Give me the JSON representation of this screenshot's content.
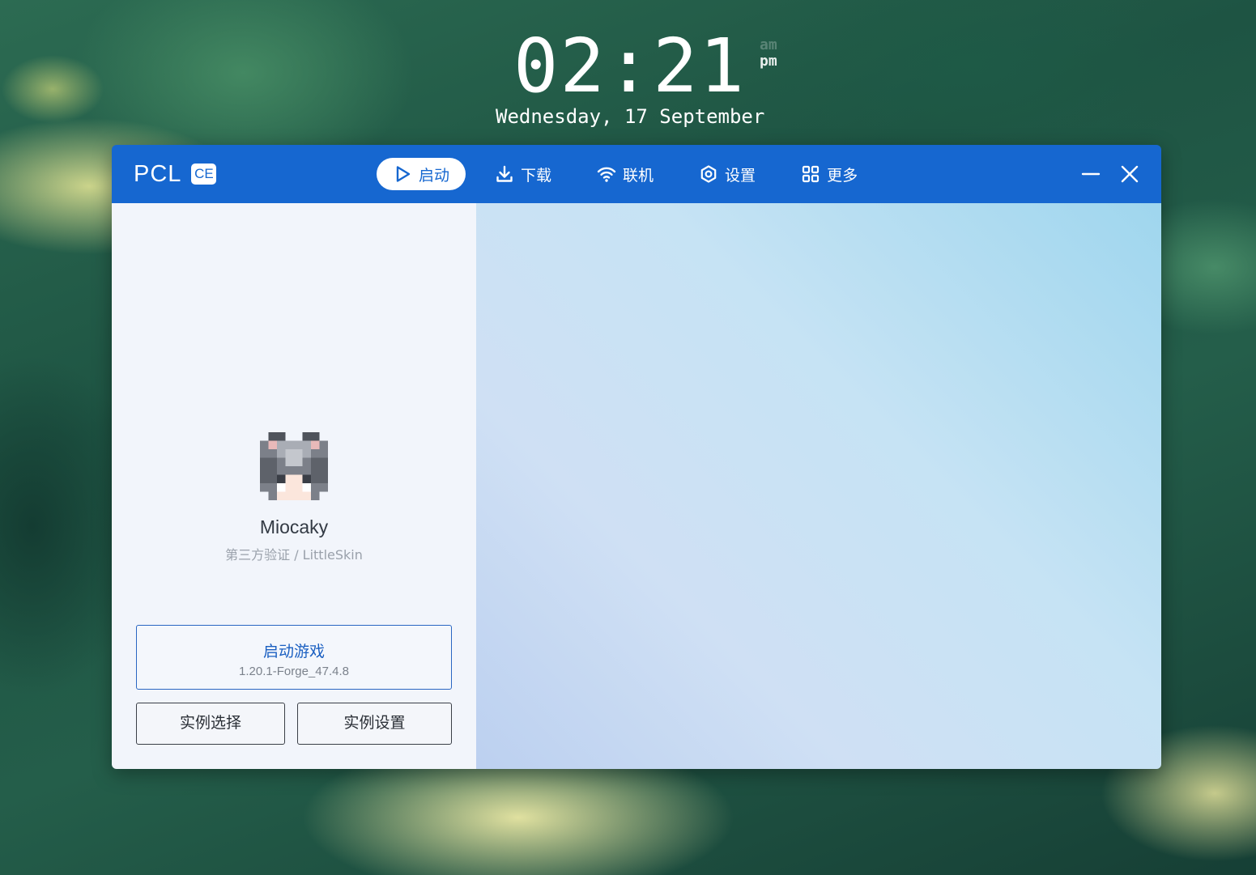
{
  "clock": {
    "time": "02:21",
    "am": "am",
    "pm": "pm",
    "date": "Wednesday, 17 September"
  },
  "app": {
    "brand": "PCL",
    "badge": "CE",
    "accent": "#1667d0"
  },
  "nav": {
    "items": [
      {
        "label": "启动",
        "icon": "play-icon",
        "active": true
      },
      {
        "label": "下载",
        "icon": "download-icon",
        "active": false
      },
      {
        "label": "联机",
        "icon": "wifi-icon",
        "active": false
      },
      {
        "label": "设置",
        "icon": "gear-icon",
        "active": false
      },
      {
        "label": "更多",
        "icon": "grid-icon",
        "active": false
      }
    ]
  },
  "window_controls": {
    "minimize": "minimize-icon",
    "close": "close-icon"
  },
  "user": {
    "name": "Miocaky",
    "auth": "第三方验证 / LittleSkin"
  },
  "launch": {
    "title": "启动游戏",
    "version": "1.20.1-Forge_47.4.8"
  },
  "buttons": {
    "select_instance": "实例选择",
    "instance_settings": "实例设置"
  }
}
